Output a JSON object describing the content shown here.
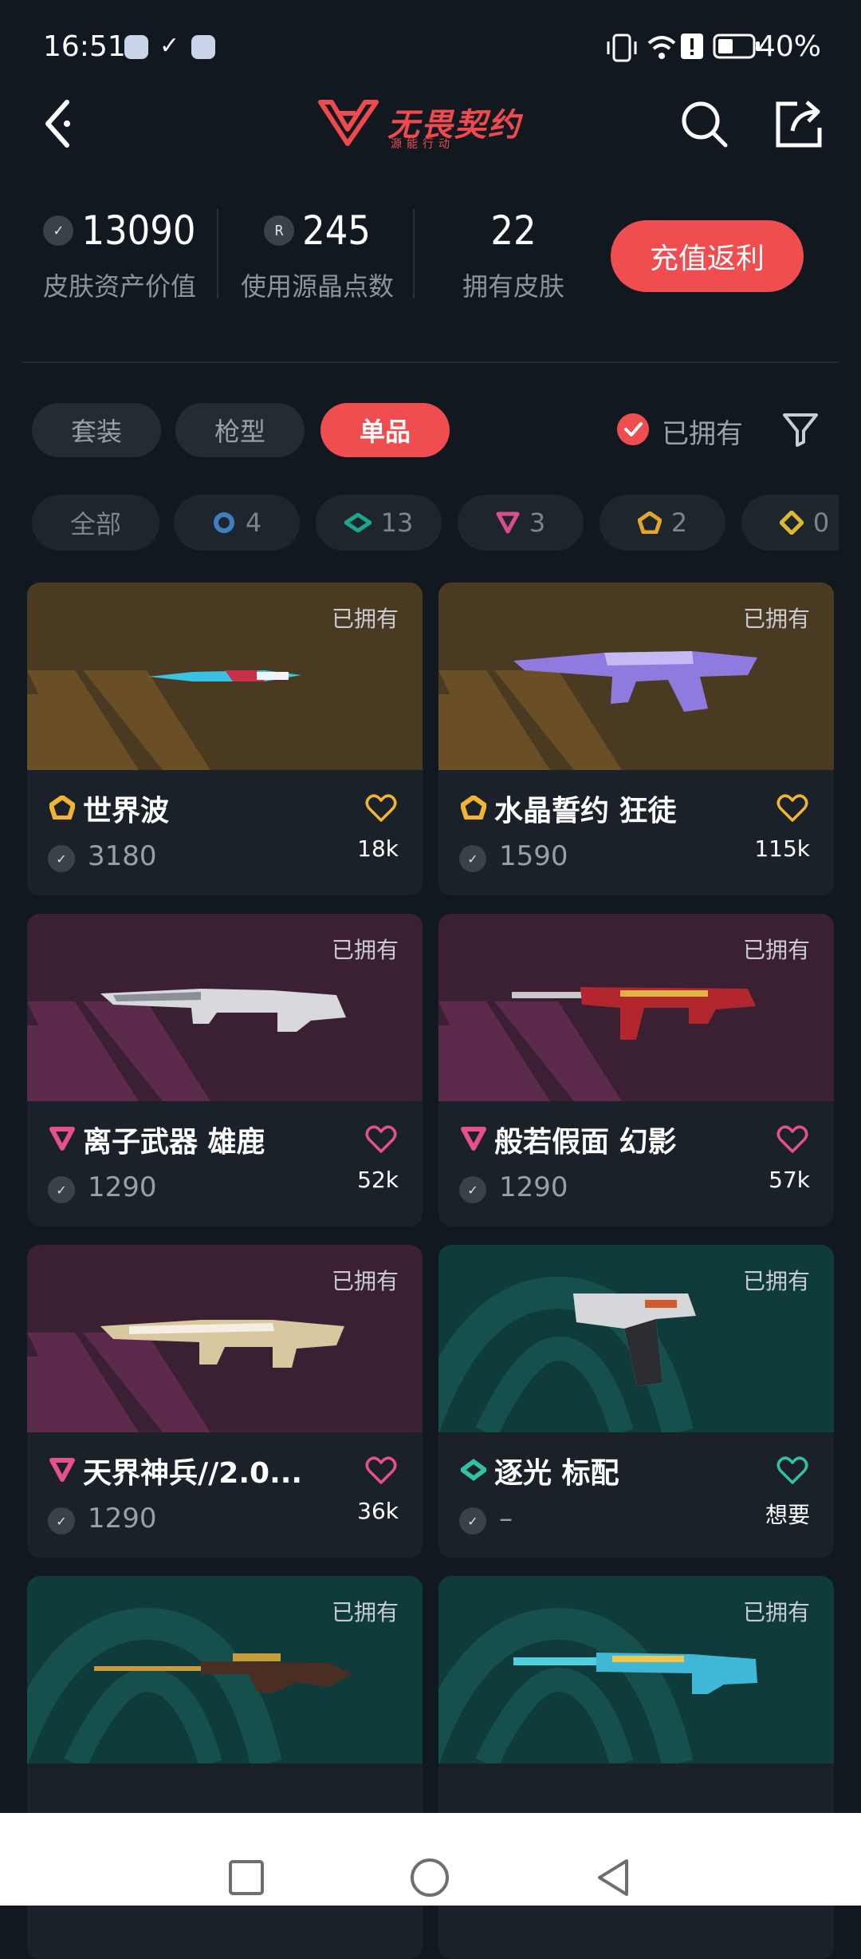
{
  "status": {
    "time": "16:51",
    "battery": "40%"
  },
  "header": {
    "logo_text": "无畏契约",
    "logo_sub": "源能行动"
  },
  "stats": [
    {
      "value": "13090",
      "label": "皮肤资产价值",
      "icon": "vp-coin-icon"
    },
    {
      "value": "245",
      "label": "使用源晶点数",
      "icon": "radianite-icon"
    },
    {
      "value": "22",
      "label": "拥有皮肤",
      "icon": ""
    }
  ],
  "recharge_label": "充值返利",
  "tabs": [
    "套装",
    "枪型",
    "单品"
  ],
  "active_tab": "单品",
  "owned_filter_label": "已拥有",
  "rarity_chips": [
    {
      "label": "全部",
      "count": ""
    },
    {
      "label": "",
      "count": "4",
      "color": "#3d7fc2"
    },
    {
      "label": "",
      "count": "13",
      "color": "#1ea58f"
    },
    {
      "label": "",
      "count": "3",
      "color": "#d64f8c"
    },
    {
      "label": "",
      "count": "2",
      "color": "#e1a62c"
    },
    {
      "label": "",
      "count": "0",
      "color": "#d9b833"
    }
  ],
  "cards": [
    {
      "name": "世界波",
      "price": "3180",
      "likes": "18k",
      "owned": "已拥有",
      "tier_color": "#f3b531",
      "theme": "gold"
    },
    {
      "name": "水晶誓约 狂徒",
      "price": "1590",
      "likes": "115k",
      "owned": "已拥有",
      "tier_color": "#f3b531",
      "theme": "gold"
    },
    {
      "name": "离子武器 雄鹿",
      "price": "1290",
      "likes": "52k",
      "owned": "已拥有",
      "tier_color": "#e7508f",
      "theme": "pink"
    },
    {
      "name": "般若假面 幻影",
      "price": "1290",
      "likes": "57k",
      "owned": "已拥有",
      "tier_color": "#e7508f",
      "theme": "pink"
    },
    {
      "name": "天界神兵//2.0...",
      "price": "1290",
      "likes": "36k",
      "owned": "已拥有",
      "tier_color": "#e7508f",
      "theme": "pink"
    },
    {
      "name": "逐光 标配",
      "price": "–",
      "likes": "想要",
      "owned": "已拥有",
      "tier_color": "#2fc2a4",
      "theme": "teal"
    },
    {
      "name": "",
      "price": "",
      "likes": "",
      "owned": "已拥有",
      "tier_color": "",
      "theme": "teal"
    },
    {
      "name": "",
      "price": "",
      "likes": "",
      "owned": "已拥有",
      "tier_color": "",
      "theme": "teal"
    }
  ]
}
